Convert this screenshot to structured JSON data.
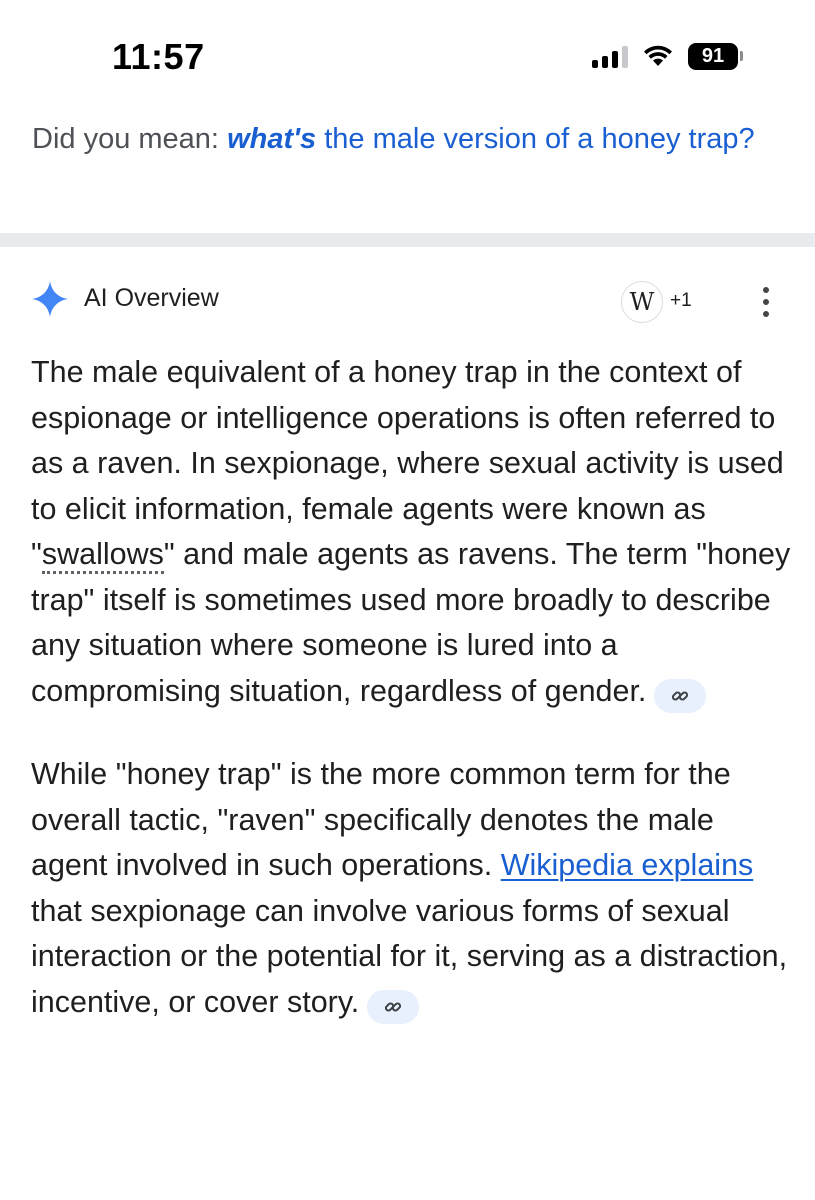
{
  "status_bar": {
    "time": "11:57",
    "battery": "91",
    "icons": [
      "signal-icon",
      "wifi-icon",
      "battery-icon"
    ]
  },
  "suggestion": {
    "prefix": "Did you mean:",
    "correction": "what's",
    "rest": "the male version of a honey trap?"
  },
  "ai_overview": {
    "title": "AI Overview",
    "source_badge": "W",
    "source_count": "+1",
    "paragraph1": {
      "before_dotted": "The male equivalent of a honey trap in the context of espionage or intelligence operations is often referred to as a raven. In sexpionage, where sexual activity is used to elicit information, female agents were known as \"",
      "dotted_term": "swallows",
      "after_dotted": "\" and male agents as ravens. The term \"honey trap\" itself is sometimes used more broadly to describe any situation where someone is lured into a compromising situation, regardless of gender."
    },
    "paragraph2": {
      "before_link": "While \"honey trap\" is the more common term for the overall tactic, \"raven\" specifically denotes the male agent involved in such operations.",
      "link_text": "Wikipedia explains",
      "after_link": "that sexpionage can involve various forms of sexual interaction or the potential for it, serving as a distraction, incentive, or cover story."
    }
  },
  "colors": {
    "link_blue": "#1a5fd1",
    "spark_blue": "#4285f4",
    "chip_bg": "#e8f0fe",
    "divider_gray": "#e8eaed"
  }
}
